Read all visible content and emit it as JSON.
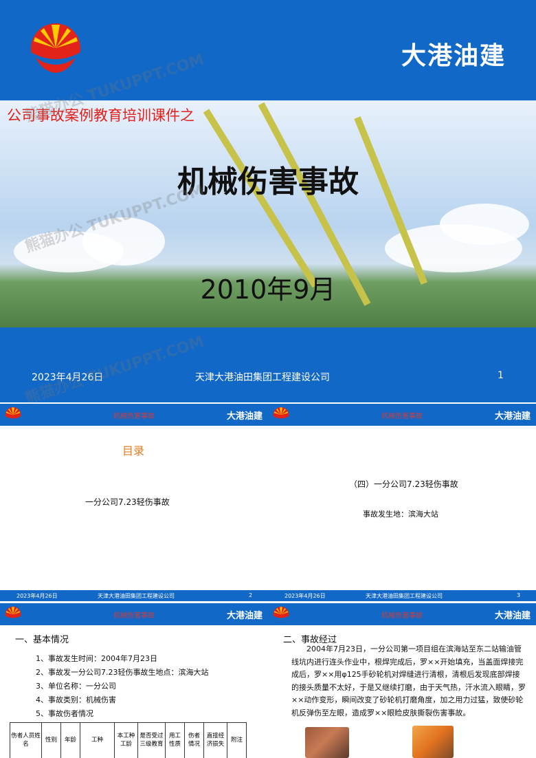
{
  "cover": {
    "brand": "大港油建",
    "subtitle": "公司事故案例教育培训课件之",
    "title": "机械伤害事故",
    "date": "2010年9月",
    "footer_date": "2023年4月26日",
    "footer_company": "天津大港油田集团工程建设公司",
    "footer_page": "1"
  },
  "header": {
    "title": "机械伤害事故",
    "brand": "大港油建"
  },
  "slide2": {
    "heading": "目录",
    "item": "一分公司7.23轻伤事故",
    "footer_date": "2023年4月26日",
    "footer_company": "天津大港油田集团工程建设公司",
    "footer_page": "2"
  },
  "slide3": {
    "heading": "（四）一分公司7.23轻伤事故",
    "location": "事故发生地：滨海大站",
    "footer_date": "2023年4月26日",
    "footer_company": "天津大港油田集团工程建设公司",
    "footer_page": "3"
  },
  "slide4": {
    "heading": "一、基本情况",
    "items": [
      "1、事故发生时间：2004年7月23日",
      "2、事故发一分公司7.23轻伤事故生地点：滨海大站",
      "3、单位名称：一分公司",
      "4、事故类别：机械伤害",
      "5、事故伤者情况"
    ],
    "table_headers": [
      "伤者人员姓名",
      "性别",
      "年龄",
      "工种",
      "本工种工龄",
      "是否受过三级教育",
      "用工性质",
      "伤者情况",
      "直接经济损失",
      "附注"
    ]
  },
  "slide5": {
    "heading": "二、事故经过",
    "body": "2004年7月23日，一分公司第一项目组在滨海站至东二站输油管线坑内进行连头作业中，根焊完成后，罗××开始填充，当盖面焊接完成后，罗××用φ125手砂轮机对焊缝进行清根，清根后发现底部焊接的接头质量不太好，于是又继续打磨，由于天气热，汗水流入眼睛，罗××动作变形，瞬间改变了砂轮机打磨角度，加之用力过猛，致使砂轮机反弹伤至左眼，造成罗××眼睑皮肤撕裂伤害事故。"
  },
  "watermark": "熊猫办公 TUKUPPT.COM",
  "colors": {
    "primary_blue": "#1268c7",
    "accent_red": "#e0211c",
    "logo_red": "#e2231a",
    "logo_yellow": "#ffcc00"
  }
}
